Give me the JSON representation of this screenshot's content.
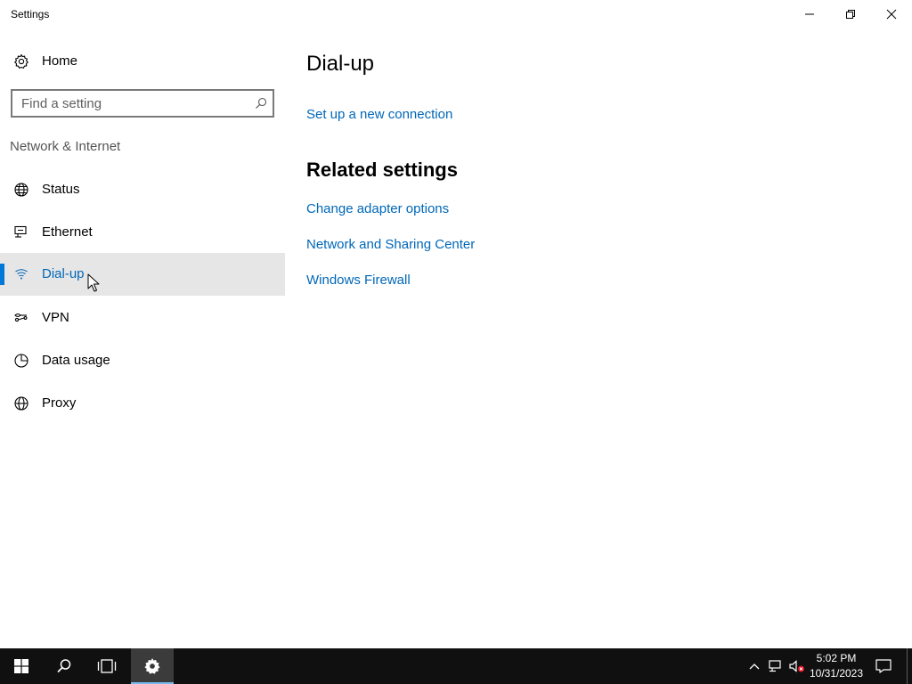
{
  "window": {
    "title": "Settings"
  },
  "sidebar": {
    "home_label": "Home",
    "search_placeholder": "Find a setting",
    "section_title": "Network & Internet",
    "items": [
      {
        "label": "Status",
        "icon": "globe-status-icon"
      },
      {
        "label": "Ethernet",
        "icon": "ethernet-icon"
      },
      {
        "label": "Dial-up",
        "icon": "dialup-icon",
        "selected": true
      },
      {
        "label": "VPN",
        "icon": "vpn-icon"
      },
      {
        "label": "Data usage",
        "icon": "data-usage-icon"
      },
      {
        "label": "Proxy",
        "icon": "globe-proxy-icon"
      }
    ]
  },
  "main": {
    "title": "Dial-up",
    "setup_link": "Set up a new connection",
    "related_title": "Related settings",
    "related_links": [
      "Change adapter options",
      "Network and Sharing Center",
      "Windows Firewall"
    ]
  },
  "taskbar": {
    "time": "5:02 PM",
    "date": "10/31/2023"
  },
  "colors": {
    "accent": "#0078d7",
    "link": "#0067b8",
    "selected_bg": "#e6e6e6",
    "taskbar_bg": "#101010"
  }
}
